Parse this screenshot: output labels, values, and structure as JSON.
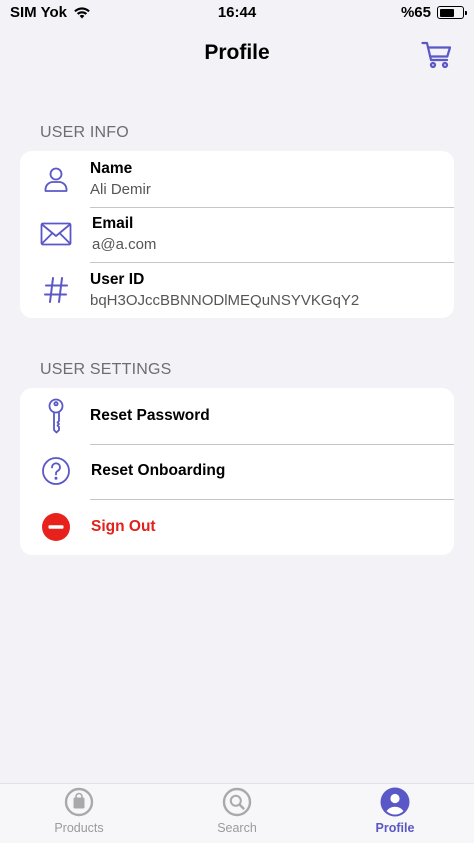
{
  "status_bar": {
    "carrier": "SIM Yok",
    "time": "16:44",
    "battery": "%65",
    "battery_level": 0.65
  },
  "nav": {
    "title": "Profile",
    "cart_icon": "cart-icon"
  },
  "user_info": {
    "header": "USER INFO",
    "items": [
      {
        "icon": "person-icon",
        "label": "Name",
        "value": "Ali Demir"
      },
      {
        "icon": "envelope-icon",
        "label": "Email",
        "value": "a@a.com"
      },
      {
        "icon": "hash-icon",
        "label": "User ID",
        "value": "bqH3OJccBBNNODlMEQuNSYVKGqY2"
      }
    ]
  },
  "user_settings": {
    "header": "USER SETTINGS",
    "items": [
      {
        "icon": "key-icon",
        "label": "Reset Password"
      },
      {
        "icon": "question-circle-icon",
        "label": "Reset Onboarding"
      },
      {
        "icon": "minus-circle-icon",
        "label": "Sign Out"
      }
    ]
  },
  "tabs": [
    {
      "icon": "bag-icon",
      "label": "Products",
      "active": false
    },
    {
      "icon": "magnifier-icon",
      "label": "Search",
      "active": false
    },
    {
      "icon": "person-circle-icon",
      "label": "Profile",
      "active": true
    }
  ],
  "colors": {
    "accent": "#5a57c6",
    "danger": "#e0211c",
    "background": "#f2f2f7"
  }
}
